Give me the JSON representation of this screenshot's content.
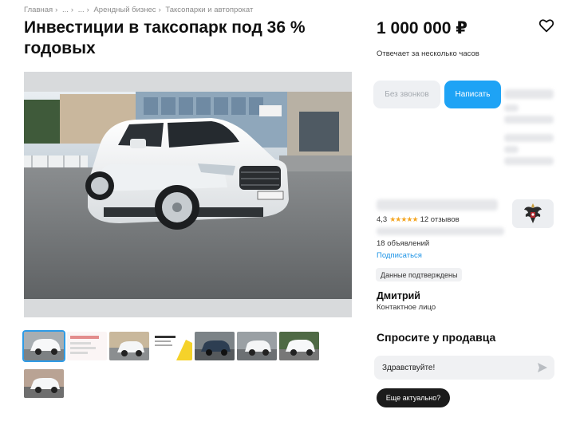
{
  "breadcrumb": {
    "items": [
      "Главная",
      "...",
      "...",
      "Арендный бизнес",
      "Таксопарки и автопрокат"
    ],
    "separator": "›"
  },
  "title": "Инвестиции в таксопарк под 36 % годовых",
  "price": "1 000 000 ₽",
  "replies_text": "Отвечает за несколько часов",
  "buttons": {
    "no_calls": "Без звонков",
    "write": "Написать",
    "is_actual": "Еще актуально?"
  },
  "seller": {
    "rating": "4,3",
    "stars": "★★★★★",
    "reviews": "12 отзывов",
    "ads_count": "18 объявлений",
    "subscribe": "Подписаться",
    "verified": "Данные подтверждены",
    "name": "Дмитрий",
    "role": "Контактное лицо"
  },
  "ask": {
    "title": "Спросите у продавца",
    "message_value": "Здравствуйте!"
  },
  "gallery": {
    "thumbnail_count": 8,
    "active_index": 0
  },
  "colors": {
    "accent": "#1ea3f5",
    "link": "#1e94e6",
    "stars": "#f4a623",
    "dark_button": "#1b1b1b"
  },
  "icons": {
    "favorite": "heart-outline-icon",
    "send": "send-arrow-icon",
    "avatar": "double-eagle-emblem-icon"
  }
}
